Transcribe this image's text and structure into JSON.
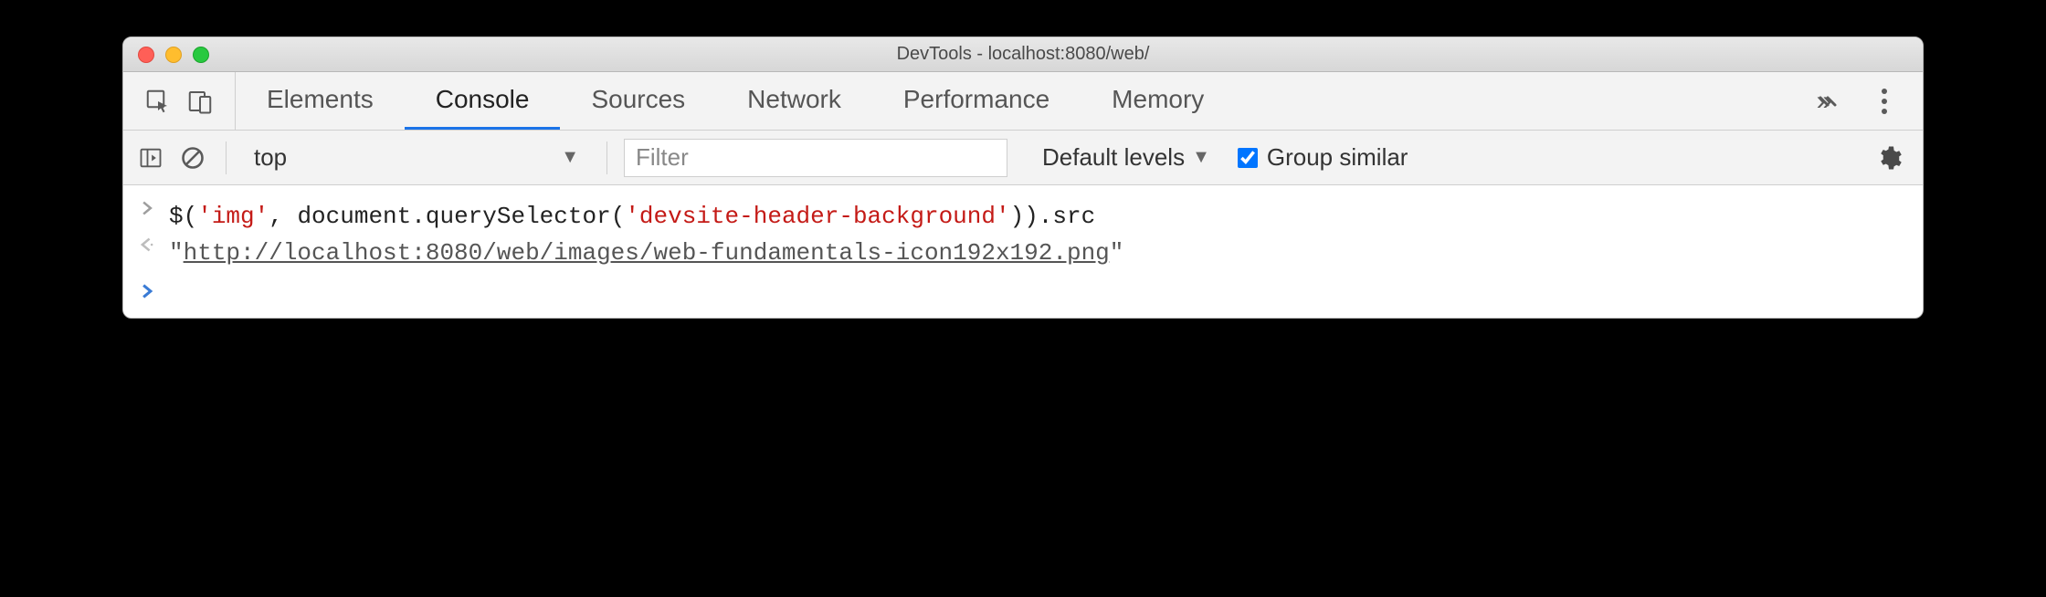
{
  "window": {
    "title": "DevTools - localhost:8080/web/"
  },
  "tabs": {
    "items": [
      "Elements",
      "Console",
      "Sources",
      "Network",
      "Performance",
      "Memory"
    ],
    "active_index": 1
  },
  "toolbar": {
    "context": "top",
    "filter_placeholder": "Filter",
    "levels_label": "Default levels",
    "group_similar_label": "Group similar",
    "group_similar_checked": true
  },
  "console": {
    "input_parts": {
      "p0": "$(",
      "s0": "'img'",
      "p1": ", document.querySelector(",
      "s1": "'devsite-header-background'",
      "p2": ")).src"
    },
    "output_parts": {
      "q": "\"",
      "url": "http://localhost:8080/web/images/web-fundamentals-icon192x192.png"
    }
  }
}
